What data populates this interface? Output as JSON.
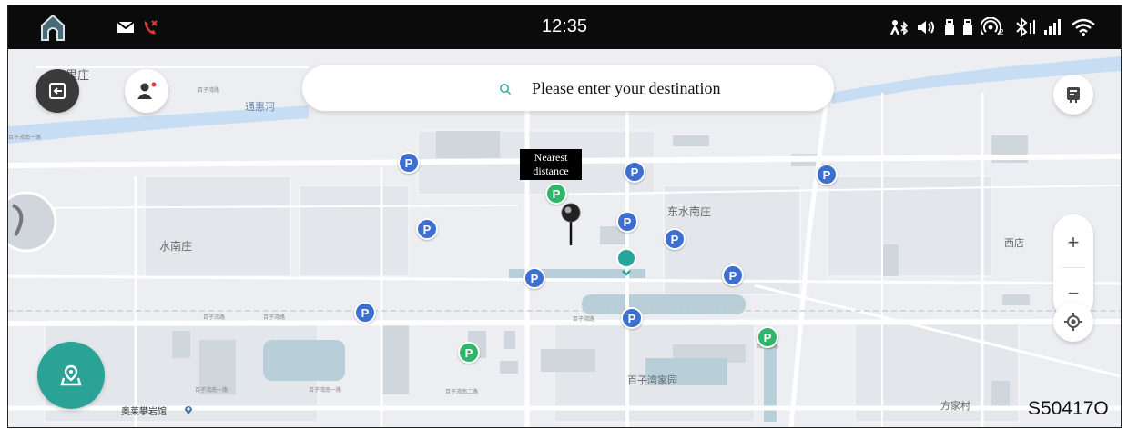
{
  "status_bar": {
    "time": "12:35",
    "left_icons": [
      "home-icon",
      "mail-icon",
      "missed-call-icon"
    ],
    "right_icons": [
      "bluetooth-audio-icon",
      "volume-icon",
      "usb-icon",
      "usb-icon-2",
      "hotspot-icon",
      "bluetooth-icon",
      "signal-icon",
      "wifi-icon"
    ]
  },
  "search": {
    "placeholder": "Please enter your destination",
    "icon": "search-icon"
  },
  "map": {
    "labels": [
      "八里庄",
      "通惠河",
      "水南庄",
      "东水南庄",
      "西店",
      "百子湾家园",
      "奥莱攀岩馆",
      "方家村"
    ],
    "street_labels": [
      "百子湾路",
      "百子湾路",
      "百子湾路",
      "百子湾南一路",
      "百子湾南一路",
      "百子湾南二路",
      "百子湾路",
      "百子湾南一路",
      "西大望路"
    ],
    "nearest_label": "Nearest distance",
    "parking_symbol": "P",
    "colors": {
      "parking_blue": "#3d6fd1",
      "parking_green": "#2eb76a",
      "river": "#c7ddf3",
      "current_location": "#26a69a",
      "locate_fab": "#2aa396"
    }
  },
  "controls": {
    "zoom_in": "+",
    "zoom_out": "−"
  },
  "figure_code": "S50417O"
}
